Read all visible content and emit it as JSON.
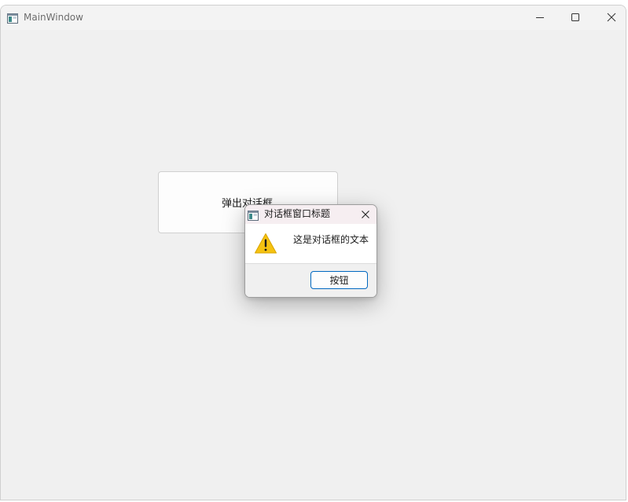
{
  "window": {
    "title": "MainWindow",
    "icon": "app-window-icon",
    "controls": {
      "minimize_icon": "minimize-icon",
      "maximize_icon": "maximize-icon",
      "close_icon": "close-icon"
    }
  },
  "main": {
    "popup_button_label": "弹出对话框"
  },
  "dialog": {
    "title": "对话框窗口标题",
    "icon": "app-window-icon",
    "close_icon": "close-icon",
    "warning_icon": "warning-icon",
    "message": "这是对话框的文本",
    "button_label": "按钮"
  },
  "colors": {
    "window_bg": "#f0f0f0",
    "dialog_title_bg": "#f6eef1",
    "accent": "#0067c0",
    "warning": "#f5c211"
  }
}
